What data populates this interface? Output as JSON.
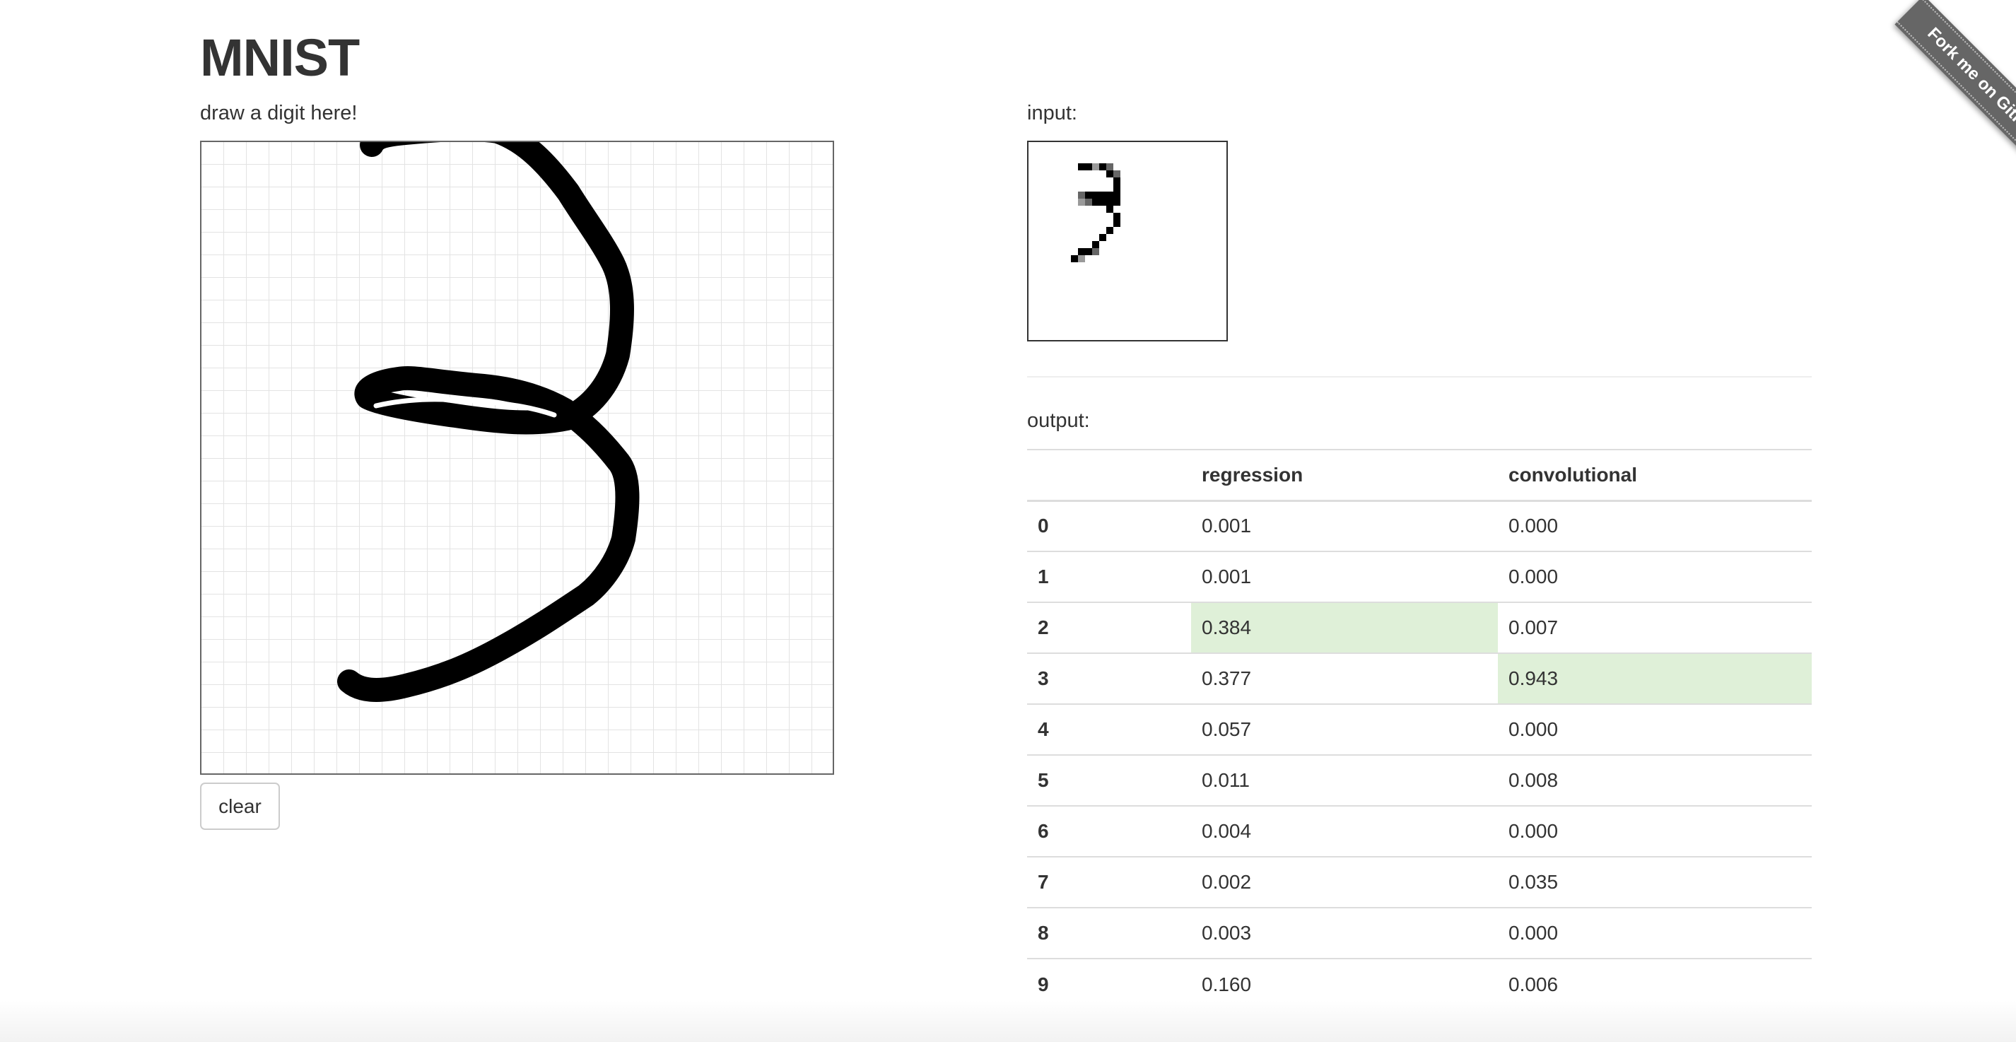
{
  "page": {
    "title": "MNIST"
  },
  "draw_panel": {
    "label": "draw a digit here!",
    "clear_label": "clear"
  },
  "input_panel": {
    "label": "input:"
  },
  "output_panel": {
    "label": "output:",
    "columns": [
      "",
      "regression",
      "convolutional"
    ],
    "rows": [
      {
        "digit": "0",
        "regression": "0.001",
        "convolutional": "0.000"
      },
      {
        "digit": "1",
        "regression": "0.001",
        "convolutional": "0.000"
      },
      {
        "digit": "2",
        "regression": "0.384",
        "convolutional": "0.007"
      },
      {
        "digit": "3",
        "regression": "0.377",
        "convolutional": "0.943"
      },
      {
        "digit": "4",
        "regression": "0.057",
        "convolutional": "0.000"
      },
      {
        "digit": "5",
        "regression": "0.011",
        "convolutional": "0.008"
      },
      {
        "digit": "6",
        "regression": "0.004",
        "convolutional": "0.000"
      },
      {
        "digit": "7",
        "regression": "0.002",
        "convolutional": "0.035"
      },
      {
        "digit": "8",
        "regression": "0.003",
        "convolutional": "0.000"
      },
      {
        "digit": "9",
        "regression": "0.160",
        "convolutional": "0.006"
      }
    ],
    "highlight_color": "#dff0d8"
  },
  "ribbon": {
    "label": "Fork me on GitHub",
    "color": "#666666"
  }
}
